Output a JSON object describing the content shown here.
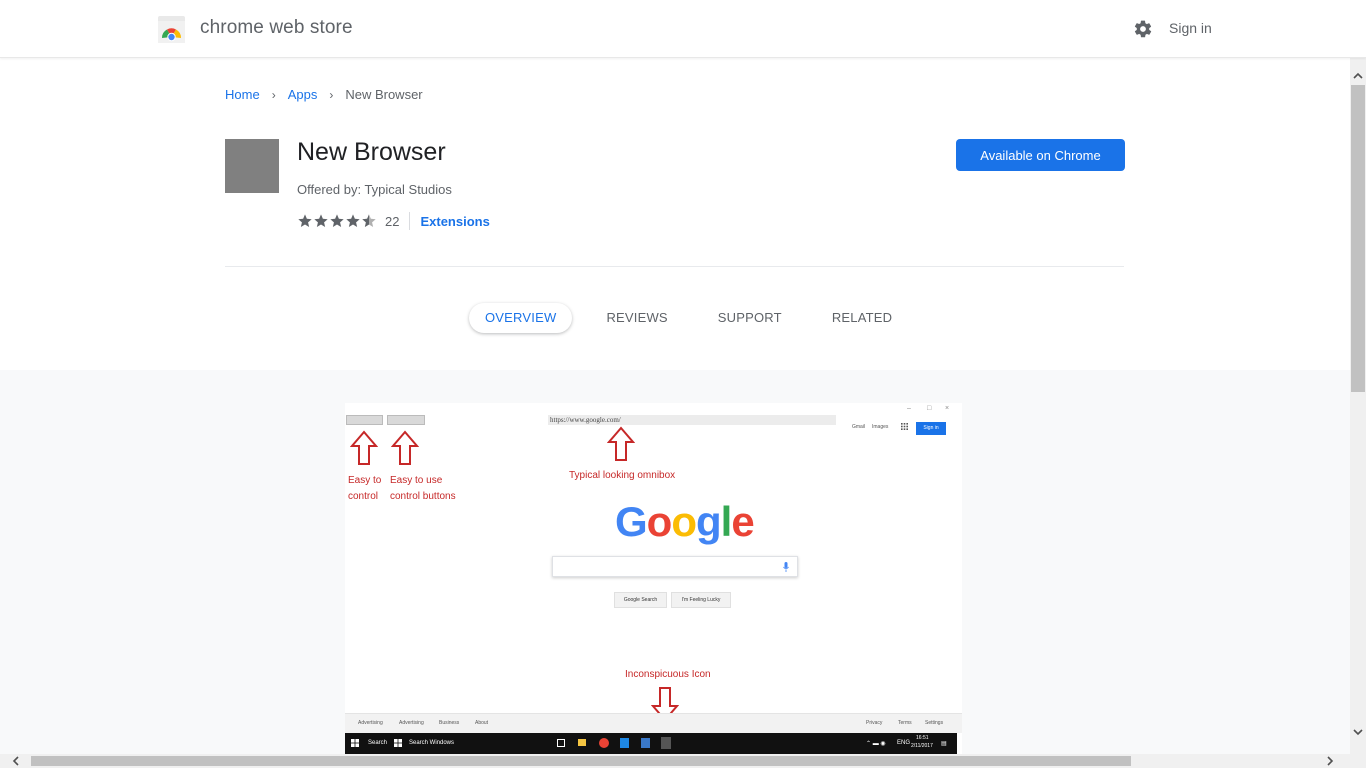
{
  "header": {
    "brand": "chrome web store",
    "signin_label": "Sign in"
  },
  "breadcrumb": {
    "items": [
      "Home",
      "Apps"
    ],
    "current": "New Browser"
  },
  "app": {
    "title": "New Browser",
    "offered_by": "Offered by: Typical Studios",
    "rating": 4.5,
    "rating_count": "22",
    "category": "Extensions",
    "install_label": "Available on Chrome"
  },
  "tabs": [
    "OVERVIEW",
    "REVIEWS",
    "SUPPORT",
    "RELATED"
  ],
  "screenshot": {
    "omnibox_url": "https://www.google.com/",
    "gmail": "Gmail",
    "images": "Images",
    "signin": "Sign in",
    "annotation_1a": "Easy to",
    "annotation_1b": "control",
    "annotation_2a": "Easy to use",
    "annotation_2b": "control buttons",
    "annotation_omnibox": "Typical looking omnibox",
    "annotation_icon": "Inconspicuous Icon",
    "google_search": "Google Search",
    "feeling_lucky": "I'm Feeling Lucky",
    "footer_left": [
      "Advertising",
      "Advertising",
      "Business",
      "About"
    ],
    "footer_right": [
      "Privacy",
      "Terms",
      "Settings"
    ],
    "taskbar_search": "Search",
    "taskbar_search_windows": "Search Windows",
    "taskbar_lang": "ENG",
    "taskbar_time": "16:51",
    "taskbar_date": "2/11/2017"
  },
  "colors": {
    "accent": "#1a73e8",
    "annotation": "#c62828"
  }
}
